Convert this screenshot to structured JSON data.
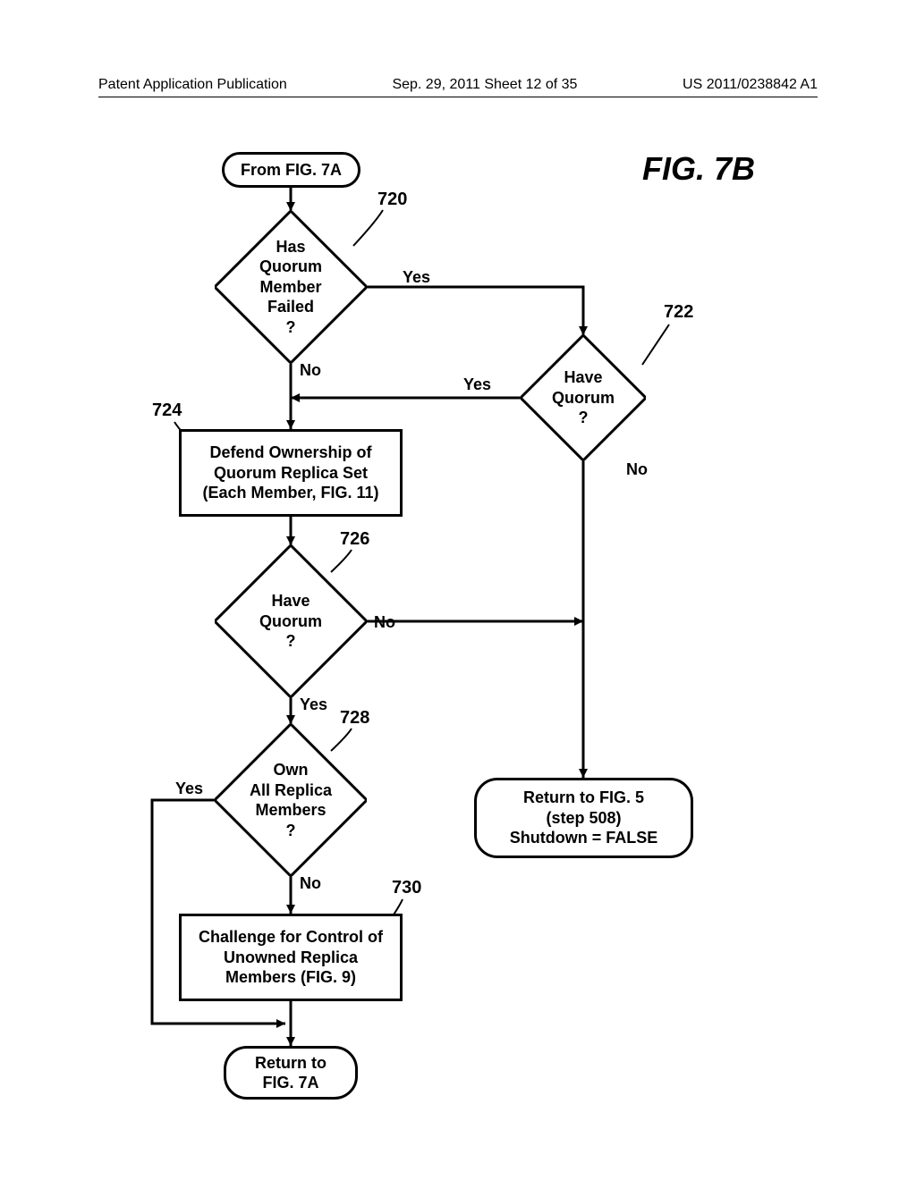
{
  "header": {
    "left": "Patent Application Publication",
    "center": "Sep. 29, 2011  Sheet 12 of 35",
    "right": "US 2011/0238842 A1"
  },
  "figure_title": "FIG. 7B",
  "nodes": {
    "start": "From FIG. 7A",
    "d720": "Has\nQuorum\nMember\nFailed\n?",
    "d722": "Have\nQuorum\n?",
    "p724": "Defend Ownership of\nQuorum Replica Set\n(Each Member, FIG. 11)",
    "d726": "Have\nQuorum\n?",
    "d728": "Own\nAll Replica\nMembers\n?",
    "p730": "Challenge for Control of\nUnowned Replica\nMembers (FIG. 9)",
    "return5": "Return to FIG. 5\n(step 508)\nShutdown = FALSE",
    "return7a": "Return to\nFIG. 7A"
  },
  "labels": {
    "yes": "Yes",
    "no": "No"
  },
  "refs": {
    "r720": "720",
    "r722": "722",
    "r724": "724",
    "r726": "726",
    "r728": "728",
    "r730": "730"
  }
}
